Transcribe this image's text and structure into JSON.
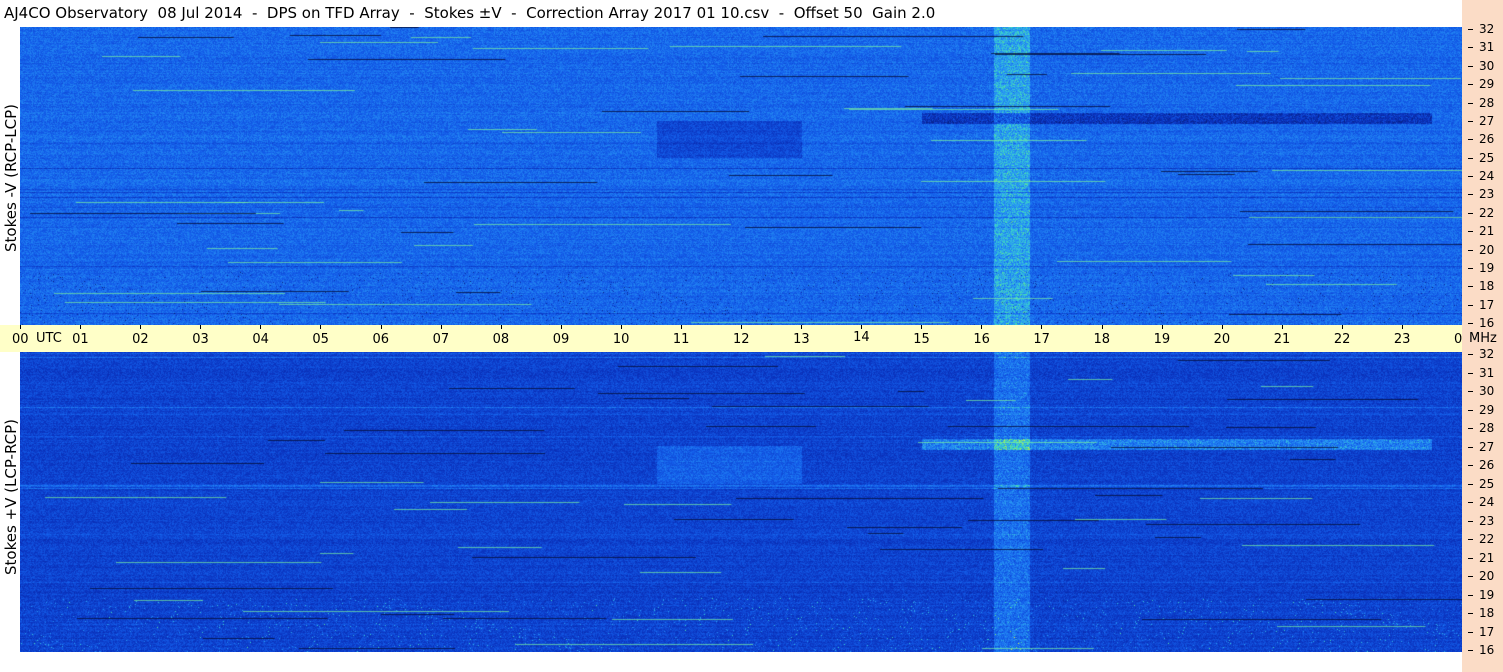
{
  "header": {
    "title": "AJ4CO Observatory  08 Jul 2014  -  DPS on TFD Array  -  Stokes ±V  -  Correction Array 2017 01 10.csv  -  Offset 50  Gain 2.0"
  },
  "chart_data": {
    "type": "heatmap",
    "panels": [
      {
        "ylabel": "Stokes -V (RCP-LCP)"
      },
      {
        "ylabel": "Stokes +V (LCP-RCP)"
      }
    ],
    "x_ticks": [
      "00",
      "01",
      "02",
      "03",
      "04",
      "05",
      "06",
      "07",
      "08",
      "09",
      "10",
      "11",
      "12",
      "13",
      "14",
      "15",
      "16",
      "17",
      "18",
      "19",
      "20",
      "21",
      "22",
      "23",
      "00"
    ],
    "x_unit": "UTC",
    "y_ticks": [
      "32",
      "31",
      "30",
      "29",
      "28",
      "27",
      "26",
      "25",
      "24",
      "23",
      "22",
      "21",
      "20",
      "19",
      "18",
      "17",
      "16"
    ],
    "y_unit": "MHz",
    "xlim": [
      0,
      24
    ],
    "ylim": [
      16,
      32
    ],
    "colors": {
      "background_low": "#0a3fc8",
      "mid": "#2c8cf0",
      "high": "#56e0a0",
      "peak": "#e0e040",
      "time_axis_bg": "#ffffc8",
      "freq_axis_bg": "#fbdcc6"
    }
  }
}
